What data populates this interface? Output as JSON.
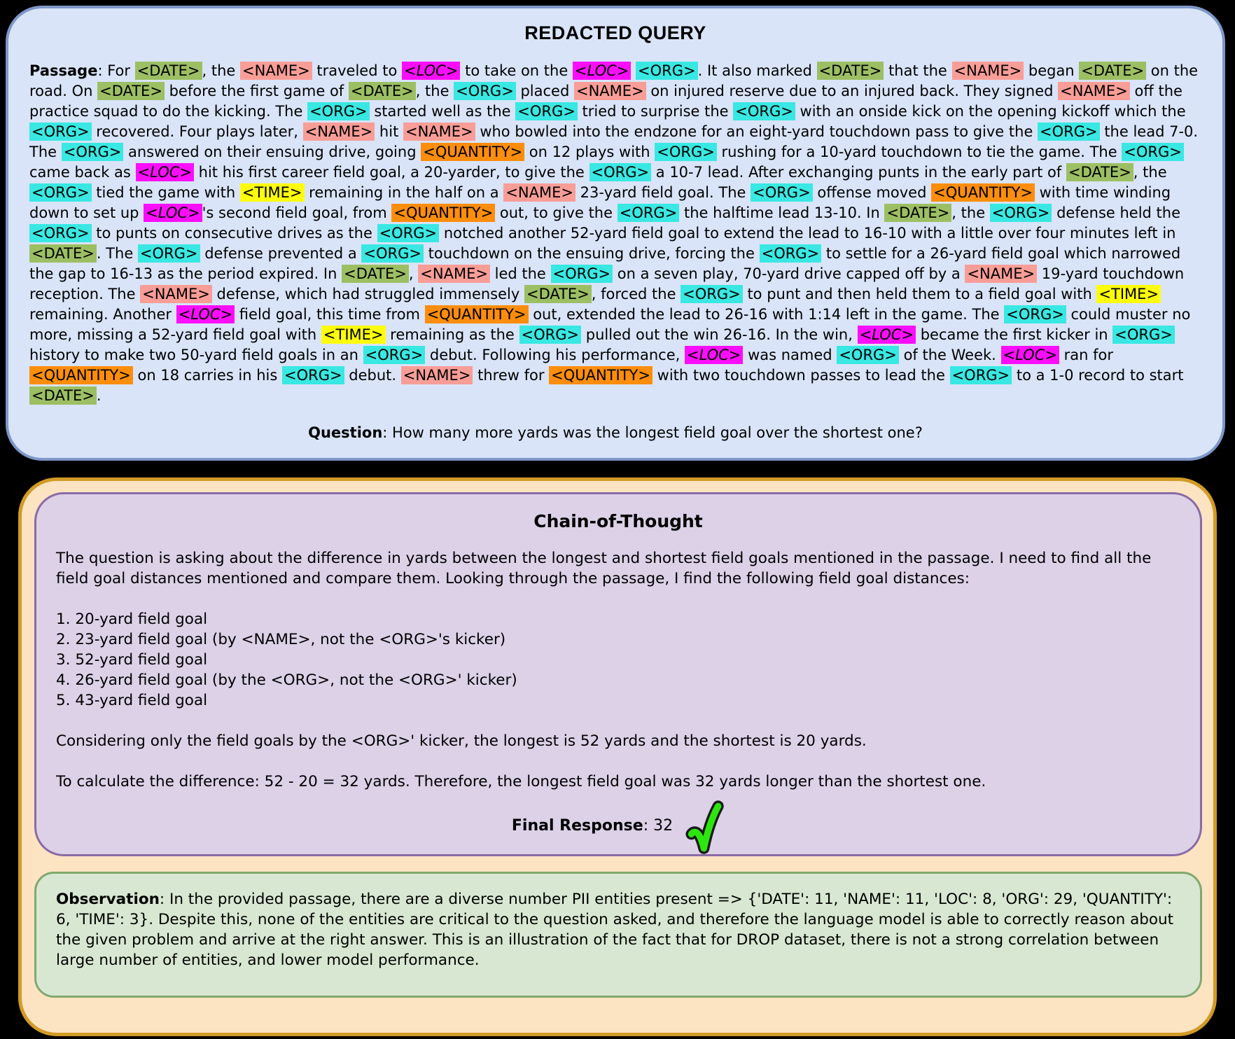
{
  "entity_colors": {
    "DATE": "#9cbf63",
    "NAME": "#f99d97",
    "LOC": "#fb0efb",
    "ORG": "#39e8e2",
    "QUANTITY": "#fc8d0d",
    "TIME": "#fdfd0c"
  },
  "accent_colors": {
    "query_panel_border": "#7e97c9",
    "query_panel_bg": "#d9e4f8",
    "outer_container_border": "#d29b26",
    "outer_container_bg": "#fce3c2",
    "cot_panel_border": "#8a6ba5",
    "cot_panel_bg": "#dcd1e7",
    "observation_panel_border": "#81a96f",
    "observation_panel_bg": "#d8e7d2",
    "check_green": "#2ee60f"
  },
  "query": {
    "title": "REDACTED QUERY",
    "passage_label": "Passage",
    "passage": ": For <DATE>, the <NAME> traveled to <LOC> to take on the <LOC> <ORG>. It also marked <DATE> that the <NAME> began <DATE> on the road. On <DATE> before the first game of <DATE>, the <ORG> placed <NAME> on injured reserve due to an injured back. They signed <NAME> off the practice squad to do the kicking. The <ORG> started well as the <ORG> tried to surprise the <ORG> with an onside kick on the opening kickoff which the <ORG> recovered. Four plays later, <NAME> hit <NAME> who bowled into the endzone for an eight-yard touchdown pass to give the <ORG> the lead 7-0. The <ORG> answered on their ensuing drive, going <QUANTITY> on 12 plays with <ORG> rushing for a 10-yard touchdown to tie the game. The <ORG> came back as <LOC> hit his first career field goal, a 20-yarder, to give the <ORG> a 10-7 lead. After exchanging punts in the early part of <DATE>, the <ORG> tied the game with <TIME> remaining in the half on a <NAME> 23-yard field goal. The <ORG> offense moved <QUANTITY> with time winding down to set up <LOC>'s second field goal, from <QUANTITY> out, to give the <ORG> the halftime lead 13-10. In <DATE>, the <ORG> defense held the <ORG> to punts on consecutive drives as the <ORG> notched another 52-yard field goal to extend the lead to 16-10 with a little over four minutes left in <DATE>. The <ORG> defense prevented a <ORG> touchdown on the ensuing drive, forcing the <ORG> to settle for a 26-yard field goal which narrowed the gap to 16-13 as the period expired. In <DATE>, <NAME> led the <ORG> on a seven play, 70-yard drive capped off by a <NAME> 19-yard touchdown reception. The <NAME> defense, which had struggled immensely <DATE>, forced the <ORG> to punt and then held them to a field goal with <TIME> remaining. Another <LOC> field goal, this time from <QUANTITY> out, extended the lead to 26-16 with 1:14 left in the game. The <ORG> could muster no more, missing a 52-yard field goal with <TIME> remaining as the <ORG> pulled out the win 26-16. In the win, <LOC> became the first kicker in <ORG> history to make two 50-yard field goals in an <ORG> debut. Following his performance, <LOC> was named <ORG> of the Week. <LOC> ran for <QUANTITY> on 18 carries in his <ORG> debut. <NAME> threw for <QUANTITY> with two touchdown passes to lead the <ORG> to a 1-0 record to start <DATE>.",
    "question_label": "Question",
    "question": ": How many more yards was the longest field goal over the shortest one?"
  },
  "cot": {
    "title": "Chain-of-Thought",
    "p1": "The question is asking about the difference in yards between the longest and shortest field goals mentioned in the passage. I need to find all the field goal distances mentioned and compare them. Looking through the passage, I find the following field goal distances:",
    "list": [
      "1. 20-yard field goal",
      "2. 23-yard field goal (by <NAME>, not the <ORG>'s kicker)",
      "3. 52-yard field goal",
      "4. 26-yard field goal (by the <ORG>, not the <ORG>' kicker)",
      "5. 43-yard field goal"
    ],
    "p2": "Considering only the field goals by the <ORG>' kicker, the longest is 52 yards and the shortest is 20 yards.",
    "p3": "To calculate the difference: 52 - 20 = 32 yards. Therefore, the longest field goal was 32 yards longer than the shortest one.",
    "final_label": "Final Response",
    "final_text": ": 32"
  },
  "observation": {
    "label": "Observation",
    "text": ": In the provided passage, there are a diverse number PII entities present => {'DATE': 11, 'NAME': 11, 'LOC': 8, 'ORG': 29, 'QUANTITY': 6, 'TIME': 3}. Despite this, none of the entities are critical to the question asked, and therefore the language model is able to correctly reason about the given problem and arrive at the right answer. This is an illustration of the fact that for DROP dataset, there is not a strong correlation between large number of entities, and lower model performance."
  }
}
